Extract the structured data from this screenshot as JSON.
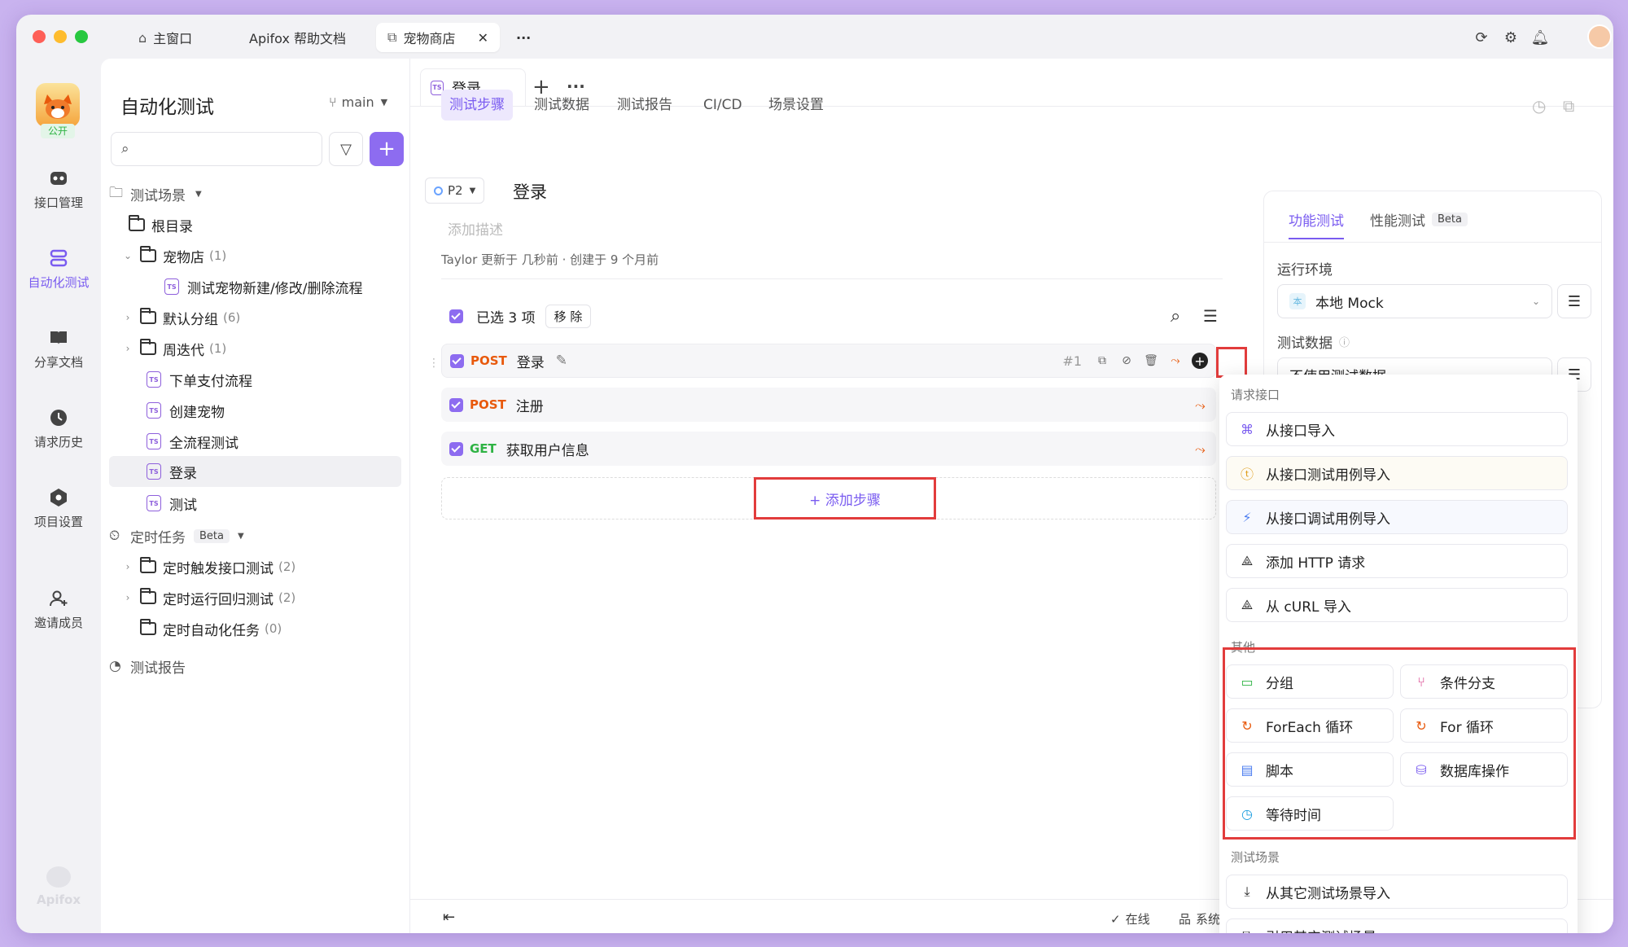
{
  "titlebar": {
    "tabs": [
      {
        "label": "主窗口",
        "icon": "home-icon"
      },
      {
        "label": "Apifox 帮助文档",
        "icon": ""
      },
      {
        "label": "宠物商店",
        "icon": "external-window-icon"
      }
    ],
    "more": "···"
  },
  "rail": {
    "badge": "公开",
    "items": [
      {
        "label": "接口管理",
        "icon": "api-icon"
      },
      {
        "label": "自动化测试",
        "icon": "automation-icon"
      },
      {
        "label": "分享文档",
        "icon": "book-icon"
      },
      {
        "label": "请求历史",
        "icon": "clock-icon"
      },
      {
        "label": "项目设置",
        "icon": "settings-icon"
      },
      {
        "label": "邀请成员",
        "icon": "add-user-icon"
      }
    ],
    "brand": "Apifox"
  },
  "sidebar": {
    "title": "自动化测试",
    "branch": "main",
    "search_placeholder": "",
    "tree": [
      {
        "label": "测试场景",
        "type": "section"
      },
      {
        "label": "根目录",
        "type": "folder"
      },
      {
        "label": "宠物店",
        "count": "(1)",
        "type": "folder"
      },
      {
        "label": "测试宠物新建/修改/删除流程",
        "type": "scene"
      },
      {
        "label": "默认分组",
        "count": "(6)",
        "type": "folder"
      },
      {
        "label": "周迭代",
        "count": "(1)",
        "type": "folder"
      },
      {
        "label": "下单支付流程",
        "type": "scene"
      },
      {
        "label": "创建宠物",
        "type": "scene"
      },
      {
        "label": "全流程测试",
        "type": "scene"
      },
      {
        "label": "登录",
        "type": "scene"
      },
      {
        "label": "测试",
        "type": "scene"
      },
      {
        "label": "定时任务",
        "badge": "Beta",
        "type": "section"
      },
      {
        "label": "定时触发接口测试",
        "count": "(2)",
        "type": "folder"
      },
      {
        "label": "定时运行回归测试",
        "count": "(2)",
        "type": "folder"
      },
      {
        "label": "定时自动化任务",
        "count": "(0)",
        "type": "folder"
      },
      {
        "label": "测试报告",
        "type": "section"
      }
    ]
  },
  "main": {
    "tab_label": "登录",
    "subtabs": [
      "测试步骤",
      "测试数据",
      "测试报告",
      "CI/CD",
      "场景设置"
    ],
    "priority": "P2",
    "scene_title": "登录",
    "desc_placeholder": "添加描述",
    "meta": "Taylor 更新于 几秒前 · 创建于 9 个月前",
    "selected_text": "已选 3 项",
    "remove_btn": "移 除",
    "steps": [
      {
        "method": "POST",
        "name": "登录",
        "index": "#1",
        "color": "#e8590c"
      },
      {
        "method": "POST",
        "name": "注册",
        "color": "#e8590c"
      },
      {
        "method": "GET",
        "name": "获取用户信息",
        "color": "#2fb344"
      }
    ],
    "add_step": "+ 添加步骤",
    "footer": {
      "online": "在线",
      "system": "系统"
    }
  },
  "rpanel": {
    "tabs": [
      "功能测试",
      "性能测试"
    ],
    "beta": "Beta",
    "env_label": "运行环境",
    "env_value": "本地 Mock",
    "env_badge": "本",
    "data_label": "测试数据",
    "data_value": "不使用测试数据"
  },
  "dropdown": {
    "sections": [
      {
        "title": "请求接口",
        "items": [
          {
            "label": "从接口导入",
            "icon": "api-import-icon",
            "color": "#7a5cf0"
          },
          {
            "label": "从接口测试用例导入",
            "icon": "tc-icon",
            "color": "#e0a020"
          },
          {
            "label": "从接口调试用例导入",
            "icon": "debug-icon",
            "color": "#4a7cf0"
          },
          {
            "label": "添加 HTTP 请求",
            "icon": "http-icon",
            "color": "#333"
          },
          {
            "label": "从 cURL 导入",
            "icon": "curl-icon",
            "color": "#333"
          }
        ]
      },
      {
        "title": "其他",
        "items": [
          {
            "label": "分组",
            "icon": "group-icon",
            "color": "#2fb344"
          },
          {
            "label": "条件分支",
            "icon": "branch-icon",
            "color": "#d63384"
          },
          {
            "label": "ForEach 循环",
            "icon": "foreach-icon",
            "color": "#e8590c"
          },
          {
            "label": "For 循环",
            "icon": "for-loop-icon",
            "color": "#e8590c"
          },
          {
            "label": "脚本",
            "icon": "script-icon",
            "color": "#4a7cf0"
          },
          {
            "label": "数据库操作",
            "icon": "database-icon",
            "color": "#7a5cf0"
          },
          {
            "label": "等待时间",
            "icon": "clock-icon",
            "color": "#1c9ee0"
          }
        ]
      },
      {
        "title": "测试场景",
        "items": [
          {
            "label": "从其它测试场景导入",
            "icon": "scene-import-icon",
            "color": "#333"
          },
          {
            "label": "引用其它测试场景",
            "icon": "scene-ref-icon",
            "color": "#333"
          }
        ]
      }
    ]
  }
}
